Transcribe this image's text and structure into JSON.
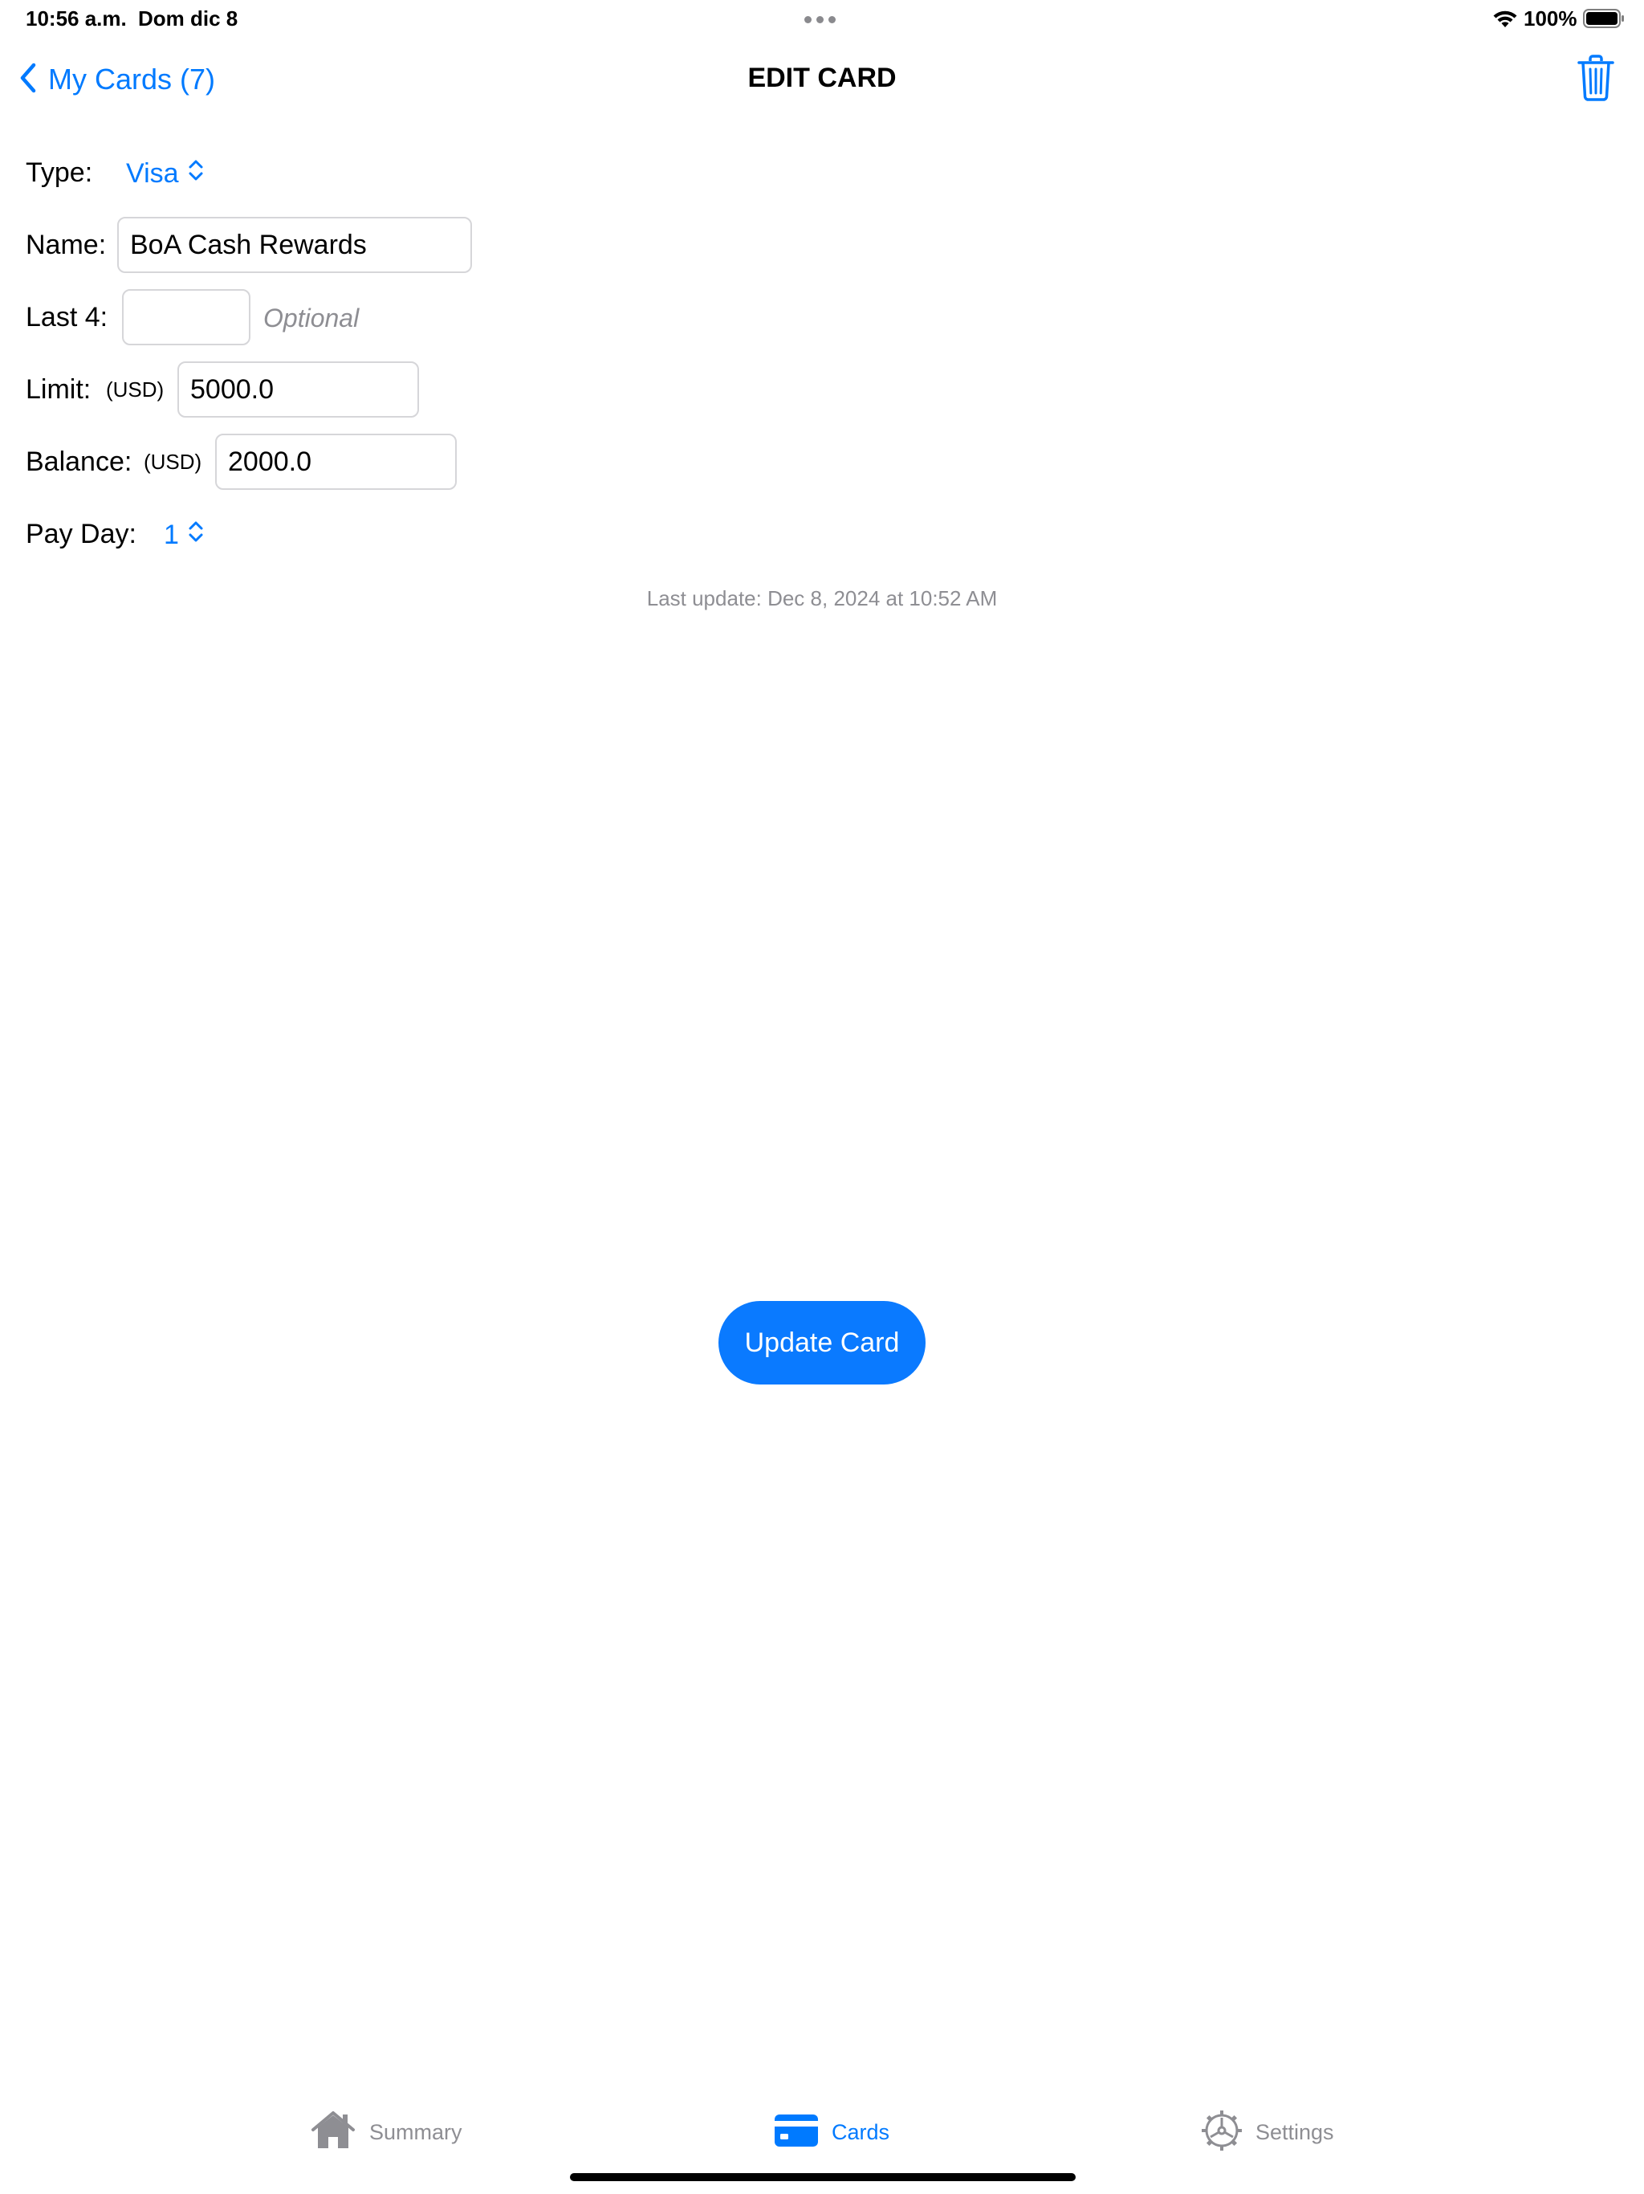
{
  "status_bar": {
    "time": "10:56 a.m.",
    "date": "Dom dic 8",
    "battery": "100%"
  },
  "nav": {
    "back_label": "My Cards (7)",
    "title": "EDIT CARD"
  },
  "form": {
    "type": {
      "label": "Type:",
      "value": "Visa"
    },
    "name": {
      "label": "Name:",
      "value": "BoA Cash Rewards"
    },
    "last4": {
      "label": "Last 4:",
      "value": "",
      "hint": "Optional"
    },
    "limit": {
      "label": "Limit:",
      "currency": "(USD)",
      "value": "5000.0"
    },
    "balance": {
      "label": "Balance:",
      "currency": "(USD)",
      "value": "2000.0"
    },
    "pay_day": {
      "label": "Pay Day:",
      "value": "1"
    }
  },
  "last_update": "Last update: Dec 8, 2024 at 10:52 AM",
  "update_button": "Update Card",
  "tabs": [
    {
      "label": "Summary",
      "icon": "house-icon",
      "active": false
    },
    {
      "label": "Cards",
      "icon": "credit-card-icon",
      "active": true
    },
    {
      "label": "Settings",
      "icon": "gear-icon",
      "active": false
    }
  ],
  "colors": {
    "accent": "#007aff",
    "inactive": "#8e8e93"
  }
}
